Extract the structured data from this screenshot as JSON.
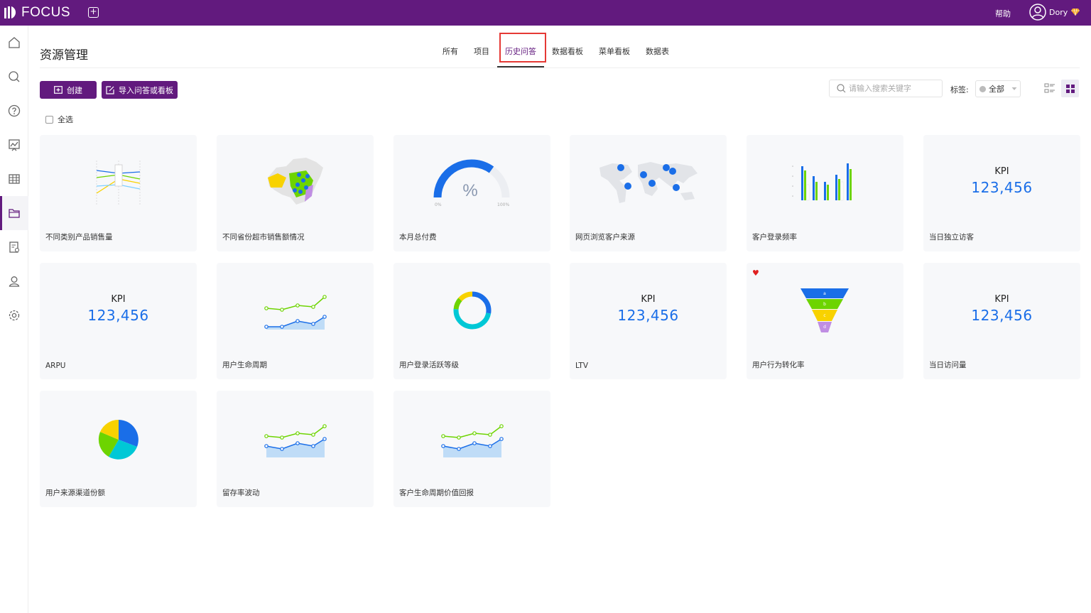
{
  "app": {
    "logo_text": "FOCUS"
  },
  "topbar": {
    "help_label": "帮助",
    "user_name": "Dory"
  },
  "page": {
    "title": "资源管理"
  },
  "tabs": [
    {
      "label": "所有"
    },
    {
      "label": "项目"
    },
    {
      "label": "历史问答"
    },
    {
      "label": "数据看板"
    },
    {
      "label": "菜单看板"
    },
    {
      "label": "数据表"
    }
  ],
  "active_tab": "历史问答",
  "toolbar": {
    "create_label": "创建",
    "import_label": "导入问答或看板",
    "search_placeholder": "请输入搜索关键字",
    "tag_label": "标签:",
    "tag_value": "全部",
    "select_all_label": "全选"
  },
  "colors": {
    "brand": "#621a7e",
    "accent_blue": "#1a6ee8",
    "highlight": "#e53935"
  },
  "sidebar": {
    "icons": [
      "home-icon",
      "search-icon",
      "help-icon",
      "dashboard-icon",
      "table-icon",
      "folder-icon",
      "report-settings-icon",
      "user-icon",
      "settings-icon"
    ],
    "active": "folder-icon"
  },
  "cards": [
    {
      "label": "不同类别产品销售量",
      "thumb": "parallel-lines"
    },
    {
      "label": "不同省份超市销售额情况",
      "thumb": "china-map"
    },
    {
      "label": "本月总付费",
      "thumb": "gauge",
      "gauge_symbol": "%",
      "gauge_min": "0%",
      "gauge_max": "100%",
      "gauge_value": 0.65
    },
    {
      "label": "网页浏览客户来源",
      "thumb": "world-map"
    },
    {
      "label": "客户登录频率",
      "thumb": "bar-chart"
    },
    {
      "label": "当日独立访客",
      "thumb": "kpi",
      "kpi_title": "KPI",
      "kpi_value": "123,456"
    },
    {
      "label": "ARPU",
      "thumb": "kpi",
      "kpi_title": "KPI",
      "kpi_value": "123,456"
    },
    {
      "label": "用户生命周期",
      "thumb": "line-area"
    },
    {
      "label": "用户登录活跃等级",
      "thumb": "donut"
    },
    {
      "label": "LTV",
      "thumb": "kpi",
      "kpi_title": "KPI",
      "kpi_value": "123,456"
    },
    {
      "label": "用户行为转化率",
      "thumb": "funnel",
      "funnel_labels": [
        "a",
        "b",
        "c",
        "d"
      ],
      "favorite": true
    },
    {
      "label": "当日访问量",
      "thumb": "kpi",
      "kpi_title": "KPI",
      "kpi_value": "123,456"
    },
    {
      "label": "用户来源渠道份额",
      "thumb": "pie"
    },
    {
      "label": "留存率波动",
      "thumb": "line-area"
    },
    {
      "label": "客户生命周期价值回报",
      "thumb": "line-area"
    }
  ]
}
